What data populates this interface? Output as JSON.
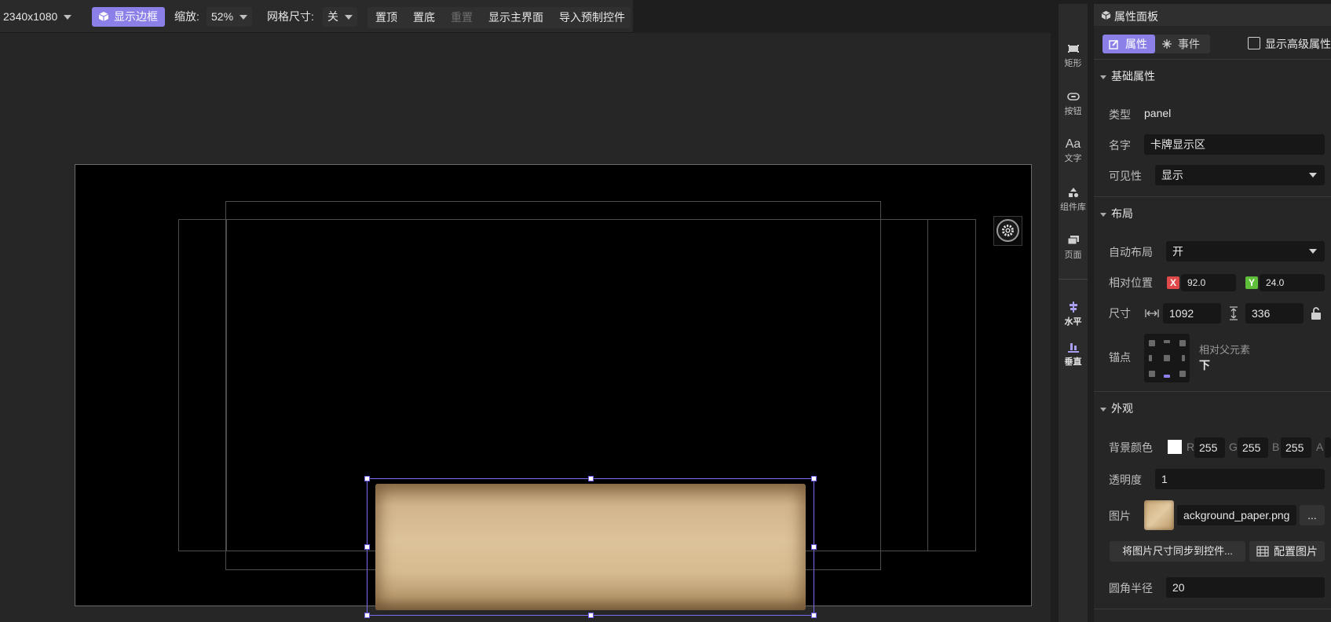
{
  "toolbar": {
    "resolution": "2340x1080",
    "show_border_label": "显示边框",
    "zoom_label": "缩放:",
    "zoom_value": "52%",
    "grid_label": "网格尺寸:",
    "grid_value": "关",
    "bring_top": "置顶",
    "send_bottom": "置底",
    "reset": "重置",
    "show_main_ui": "显示主界面",
    "import_prefab": "导入预制控件"
  },
  "tools": [
    {
      "label": "矩形",
      "icon": "rectangle-icon"
    },
    {
      "label": "按钮",
      "icon": "button-icon"
    },
    {
      "label": "文字",
      "icon": "text-icon",
      "glyph": "Aa"
    },
    {
      "label": "组件库",
      "icon": "component-library-icon"
    },
    {
      "label": "页面",
      "icon": "page-icon"
    }
  ],
  "layout_tools": [
    {
      "label": "水平",
      "icon": "horizontal-align-icon"
    },
    {
      "label": "垂直",
      "icon": "vertical-align-icon"
    }
  ],
  "panel": {
    "title": "属性面板",
    "tab_properties": "属性",
    "tab_events": "事件",
    "show_advanced": "显示高级属性",
    "basic": {
      "title": "基础属性",
      "type_label": "类型",
      "type_value": "panel",
      "name_label": "名字",
      "name_value": "卡牌显示区",
      "visibility_label": "可见性",
      "visibility_value": "显示"
    },
    "layout": {
      "title": "布局",
      "auto_layout_label": "自动布局",
      "auto_layout_value": "开",
      "position_label": "相对位置",
      "x_badge": "X",
      "x_value": "92.0",
      "y_badge": "Y",
      "y_value": "24.0",
      "size_label": "尺寸",
      "width_value": "1092",
      "height_value": "336",
      "anchor_label": "锚点",
      "anchor_relative": "相对父元素",
      "anchor_value": "下"
    },
    "appearance": {
      "title": "外观",
      "bg_color_label": "背景颜色",
      "r_label": "R",
      "r_value": "255",
      "g_label": "G",
      "g_value": "255",
      "b_label": "B",
      "b_value": "255",
      "a_label": "A",
      "opacity_label": "透明度",
      "opacity_value": "1",
      "image_label": "图片",
      "image_file": "ackground_paper.png",
      "image_more": "...",
      "sync_size_button": "将图片尺寸同步到控件...",
      "config_image_button": "配置图片",
      "radius_label": "圆角半径",
      "radius_value": "20"
    }
  },
  "colors": {
    "accent": "#8b7fe8",
    "x_badge": "#e04a4a",
    "y_badge": "#5fbf3a",
    "paper": "#d8bd93"
  }
}
